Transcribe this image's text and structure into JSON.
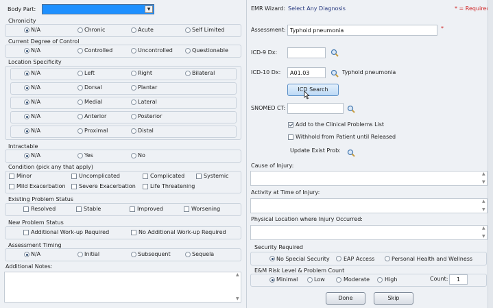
{
  "body_part": {
    "label": "Body Part:",
    "value": ""
  },
  "chronicity": {
    "title": "Chronicity",
    "options": [
      "N/A",
      "Chronic",
      "Acute",
      "Self Limited"
    ],
    "selected": "N/A"
  },
  "degree_control": {
    "title": "Current Degree of Control",
    "options": [
      "N/A",
      "Controlled",
      "Uncontrolled",
      "Questionable"
    ],
    "selected": "N/A"
  },
  "location": {
    "title": "Location Specificity",
    "rows": [
      [
        "N/A",
        "Left",
        "Right",
        "Bilateral"
      ],
      [
        "N/A",
        "Dorsal",
        "Plantar"
      ],
      [
        "N/A",
        "Medial",
        "Lateral"
      ],
      [
        "N/A",
        "Anterior",
        "Posterior"
      ],
      [
        "N/A",
        "Proximal",
        "Distal"
      ]
    ]
  },
  "intractable": {
    "title": "Intractable",
    "options": [
      "N/A",
      "Yes",
      "No"
    ]
  },
  "condition": {
    "title": "Condition (pick any that apply)",
    "row1": [
      "Minor",
      "Uncomplicated",
      "Complicated",
      "Systemic"
    ],
    "row2": [
      "Mild Exacerbation",
      "Severe  Exacerbation",
      "Life Threatening"
    ]
  },
  "existing": {
    "title": "Existing Problem Status",
    "options": [
      "Resolved",
      "Stable",
      "Improved",
      "Worsening"
    ]
  },
  "new_status": {
    "title": "New Problem Status",
    "options": [
      "Additional Work-up Required",
      "No Additional Work-up Required"
    ]
  },
  "timing": {
    "title": "Assessment Timing",
    "options": [
      "N/A",
      "Initial",
      "Subsequent",
      "Sequela"
    ]
  },
  "notes": {
    "label": "Additional Notes:",
    "value": ""
  },
  "wizard": {
    "label": "EMR Wizard:",
    "link": "Select Any Diagnosis",
    "required_note": "* = Required"
  },
  "assessment": {
    "label": "Assessment:",
    "value": "Typhoid pneumonia",
    "star": "*"
  },
  "icd9": {
    "label": "ICD-9 Dx:",
    "value": ""
  },
  "icd10": {
    "label": "ICD-10 Dx:",
    "value": "A01.03",
    "description": "Typhoid pneumonia"
  },
  "icd_search": "ICD Search",
  "snomed": {
    "label": "SNOMED CT:",
    "value": ""
  },
  "add_clinical": {
    "label": "Add to the Clinical Problems List",
    "checked": true
  },
  "withhold": {
    "label": "Withhold from Patient until Released",
    "checked": false
  },
  "update_prob": "Update Exist Prob:",
  "cause": {
    "label": "Cause of Injury:",
    "value": ""
  },
  "activity": {
    "label": "Activity at Time of Injury:",
    "value": ""
  },
  "physical": {
    "label": "Physical Location where Injury Occurred:",
    "value": ""
  },
  "security": {
    "title": "Security Required",
    "options": [
      "No Special Security",
      "EAP Access",
      "Personal Health and Wellness"
    ]
  },
  "risk": {
    "title": "E&M Risk Level & Problem Count",
    "options": [
      "Minimal",
      "Low",
      "Moderate",
      "High"
    ],
    "count_label": "Count:",
    "count": "1"
  },
  "buttons": {
    "done": "Done",
    "skip": "Skip"
  }
}
